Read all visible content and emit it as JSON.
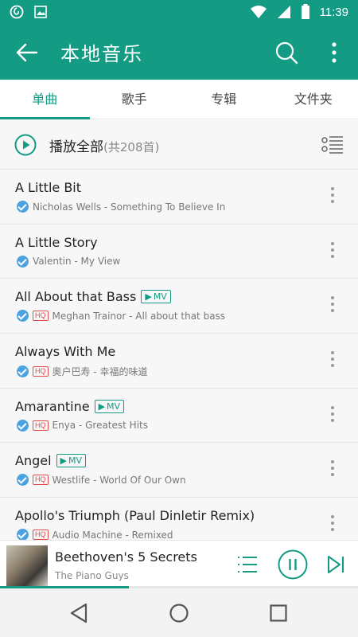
{
  "status_bar": {
    "time": "11:39",
    "left_icons": [
      "netease-music-icon",
      "image-icon"
    ],
    "right_icons": [
      "wifi-icon",
      "signal-icon",
      "battery-icon"
    ]
  },
  "app_bar": {
    "title": "本地音乐",
    "icons": [
      "back-arrow-icon",
      "search-icon",
      "more-vert-icon"
    ]
  },
  "tabs": [
    {
      "label": "单曲",
      "active": true
    },
    {
      "label": "歌手",
      "active": false
    },
    {
      "label": "专辑",
      "active": false
    },
    {
      "label": "文件夹",
      "active": false
    }
  ],
  "play_all": {
    "label": "播放全部",
    "count": "(共208首)"
  },
  "songs": [
    {
      "title": "A Little Bit",
      "mv": false,
      "hq": false,
      "subtitle": "Nicholas Wells - Something To Believe In"
    },
    {
      "title": "A Little Story",
      "mv": false,
      "hq": false,
      "subtitle": "Valentin - My View"
    },
    {
      "title": "All About that Bass",
      "mv": true,
      "hq": true,
      "subtitle": "Meghan Trainor - All about that bass"
    },
    {
      "title": "Always With Me",
      "mv": false,
      "hq": true,
      "subtitle": "奥户巴寿 - 幸福的味道"
    },
    {
      "title": "Amarantine",
      "mv": true,
      "hq": true,
      "subtitle": "Enya - Greatest Hits"
    },
    {
      "title": "Angel",
      "mv": true,
      "hq": true,
      "subtitle": "Westlife - World Of Our Own"
    },
    {
      "title": "Apollo's Triumph (Paul Dinletir Remix)",
      "mv": false,
      "hq": true,
      "subtitle": "Audio Machine - Remixed"
    }
  ],
  "badges": {
    "mv_label": "MV",
    "hq_label": "HQ"
  },
  "now_playing": {
    "title": "Beethoven's 5 Secrets",
    "artist": "The Piano Guys",
    "progress": 0.36
  },
  "colors": {
    "accent": "#139b84",
    "verified": "#4aa3e0",
    "hq": "#e24b4b"
  }
}
